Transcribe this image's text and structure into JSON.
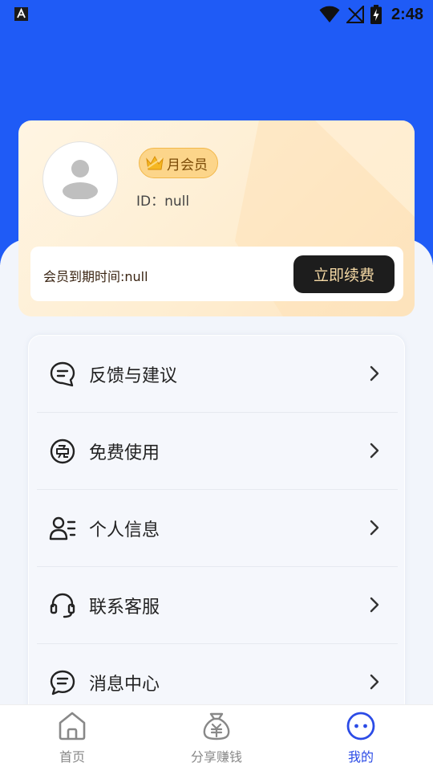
{
  "status_bar": {
    "time": "2:48",
    "icons": [
      "app-notification-icon",
      "wifi-icon",
      "no-signal-icon",
      "battery-charging-icon"
    ]
  },
  "profile": {
    "badge": "月会员",
    "user_id": "ID：null",
    "expire_text": "会员到期时间:null",
    "renew_button": "立即续费"
  },
  "menu": [
    {
      "label": "反馈与建议",
      "icon": "feedback-icon"
    },
    {
      "label": "免费使用",
      "icon": "free-icon"
    },
    {
      "label": "个人信息",
      "icon": "person-info-icon"
    },
    {
      "label": "联系客服",
      "icon": "headset-icon"
    },
    {
      "label": "消息中心",
      "icon": "message-icon"
    }
  ],
  "tabbar": {
    "tabs": [
      {
        "label": "首页",
        "icon": "home-icon",
        "active": false
      },
      {
        "label": "分享赚钱",
        "icon": "money-bag-icon",
        "active": false
      },
      {
        "label": "我的",
        "icon": "me-icon",
        "active": true
      }
    ]
  },
  "colors": {
    "header_blue": "#1f5bf6",
    "active_tab": "#2b4be6",
    "vip_gold": "#fcd58a",
    "renew_button_bg": "#1d1d1d",
    "renew_button_text": "#f5d9a5"
  }
}
